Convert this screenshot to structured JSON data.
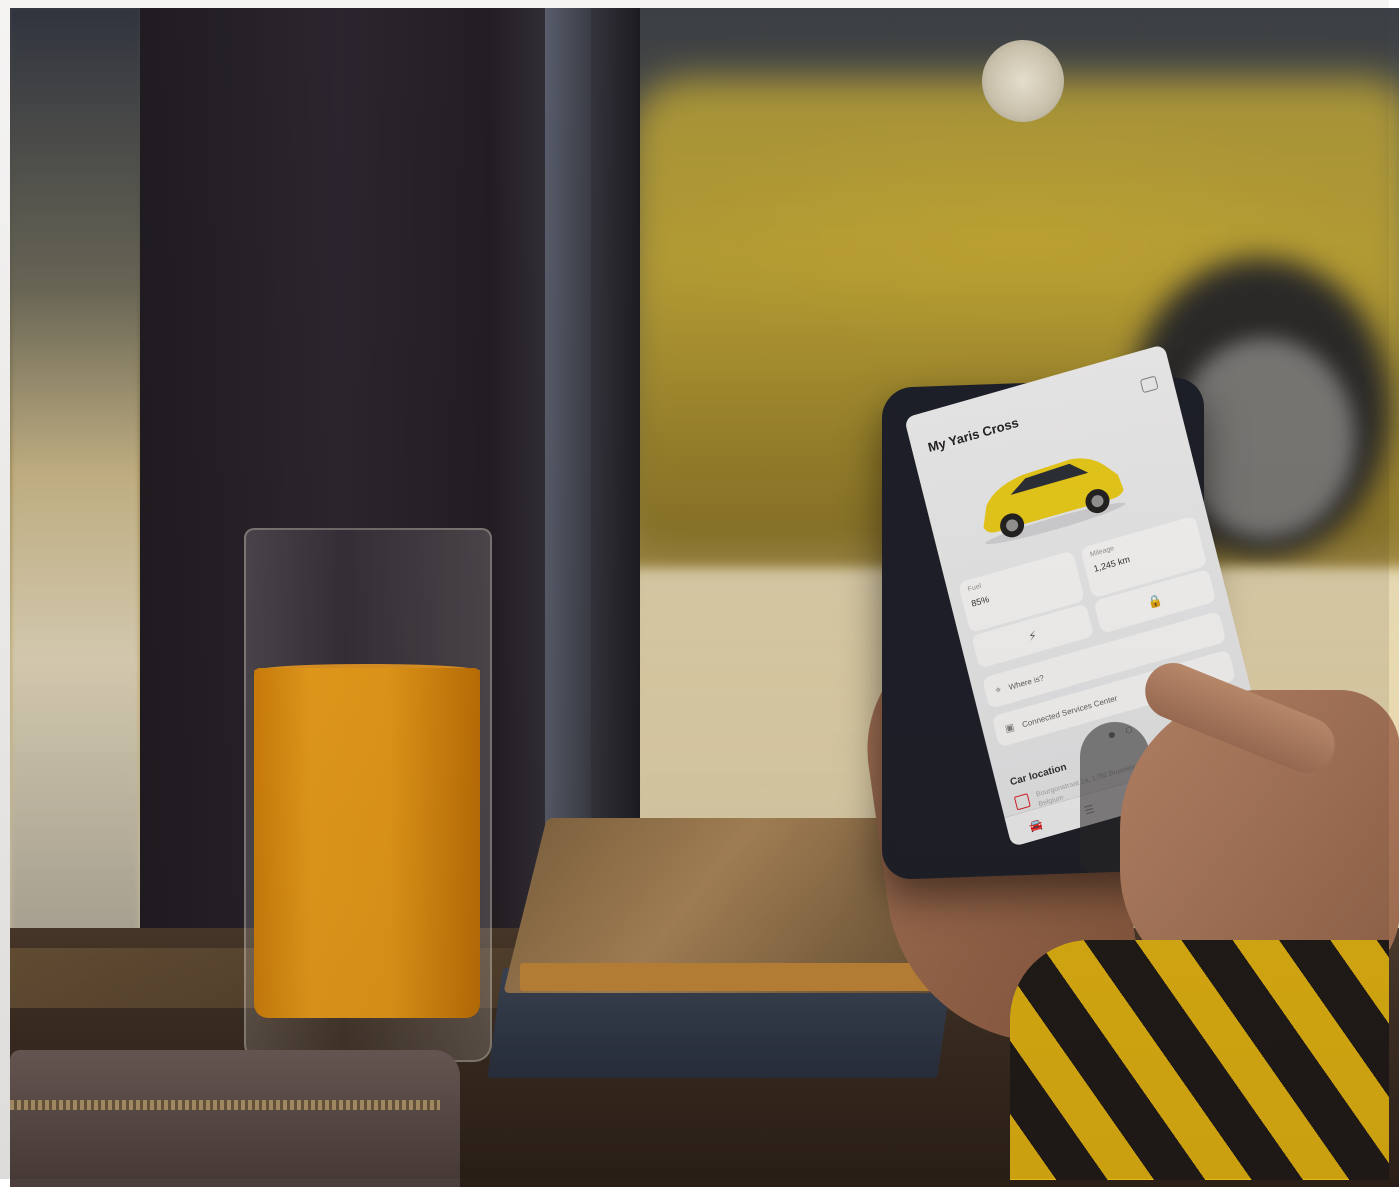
{
  "phone_app": {
    "title": "My Yaris Cross",
    "car_color": "#f1d21a",
    "stats": [
      {
        "label": "Fuel",
        "value": "85%"
      },
      {
        "label": "Mileage",
        "value": "1,245 km"
      }
    ],
    "actions": [
      {
        "icon": "lamp-icon",
        "glyph": "⚡"
      },
      {
        "icon": "lock-icon",
        "glyph": "🔒"
      }
    ],
    "menu": [
      {
        "icon": "pin-icon",
        "glyph": "⌖",
        "label": "Where is?"
      },
      {
        "icon": "connected-services-icon",
        "glyph": "▣",
        "label": "Connected Services Center"
      }
    ],
    "pagination": "● ○",
    "location": {
      "title": "Car location",
      "address": "Bourgonstraat 1a, 1782 Brussels, Belgium"
    },
    "tabs": [
      {
        "icon": "car-tab-icon",
        "glyph": "🚘"
      },
      {
        "icon": "list-tab-icon",
        "glyph": "☰"
      },
      {
        "icon": "shield-tab-icon",
        "glyph": "⛉"
      },
      {
        "icon": "calendar-tab-icon",
        "glyph": "▦"
      },
      {
        "icon": "person-tab-icon",
        "glyph": "⚇"
      }
    ],
    "accent_color": "#e0202a"
  }
}
